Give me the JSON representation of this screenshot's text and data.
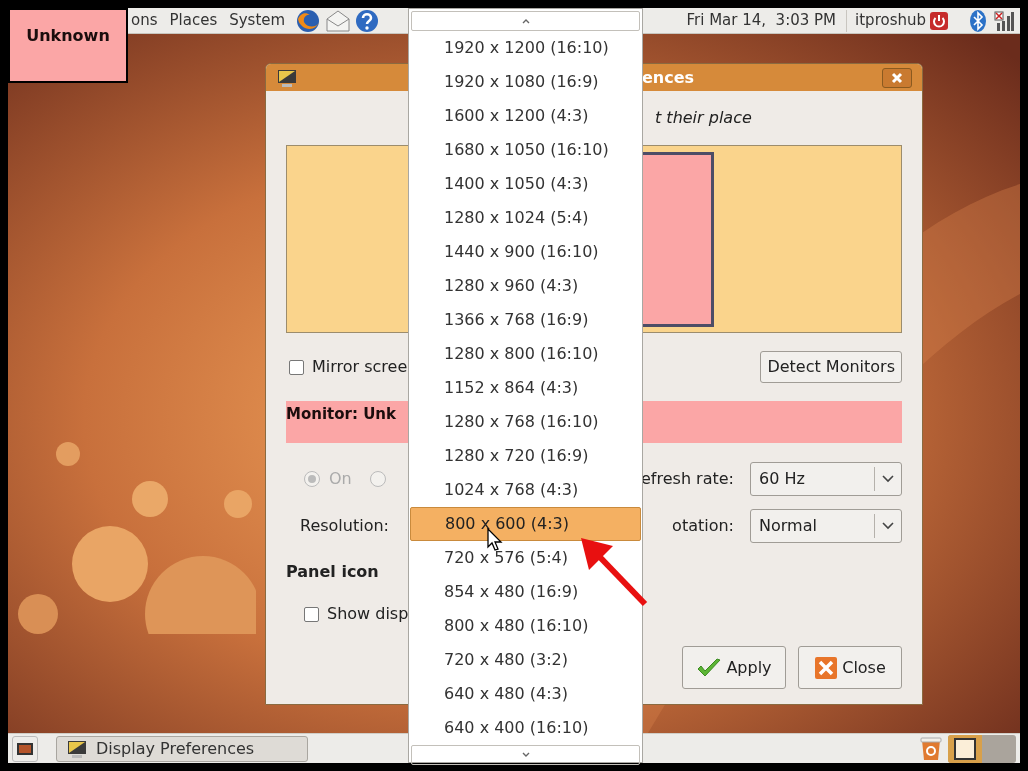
{
  "top_panel": {
    "menus": [
      {
        "label": "ons"
      },
      {
        "label": "Places"
      },
      {
        "label": "System"
      }
    ],
    "clock": "Fri Mar 14,  3:03 PM",
    "user": "itproshub"
  },
  "monitor_label": {
    "text": "Unknown"
  },
  "dialog": {
    "title": "ences",
    "hint": "t their place",
    "mirror_checkbox": {
      "label": "Mirror scree",
      "checked": false
    },
    "detect_button": {
      "label": "Detect Monitors"
    },
    "monitor_heading": "Monitor: Unk",
    "power_radios": [
      {
        "label": "On",
        "selected": true,
        "disabled": true
      },
      {
        "selected": false,
        "disabled": true
      }
    ],
    "resolution_label": "Resolution:",
    "refresh": {
      "label": "efresh rate:",
      "value": "60 Hz"
    },
    "rotation": {
      "label": "otation:",
      "value": "Normal"
    },
    "panel_icon_heading": "Panel icon",
    "show_checkbox": {
      "label": "Show disp",
      "checked": false
    },
    "buttons": [
      {
        "kind": "apply",
        "label": "Apply"
      },
      {
        "kind": "close",
        "label": "Close"
      }
    ]
  },
  "resolution_list": {
    "items": [
      {
        "label": "1920 x 1200 (16:10)",
        "selected": false
      },
      {
        "label": "1920 x 1080 (16:9)",
        "selected": false
      },
      {
        "label": "1600 x 1200 (4:3)",
        "selected": false
      },
      {
        "label": "1680 x 1050 (16:10)",
        "selected": false
      },
      {
        "label": "1400 x 1050 (4:3)",
        "selected": false
      },
      {
        "label": "1280 x 1024 (5:4)",
        "selected": false
      },
      {
        "label": "1440 x 900 (16:10)",
        "selected": false
      },
      {
        "label": "1280 x 960 (4:3)",
        "selected": false
      },
      {
        "label": "1366 x 768 (16:9)",
        "selected": false
      },
      {
        "label": "1280 x 800 (16:10)",
        "selected": false
      },
      {
        "label": "1152 x 864 (4:3)",
        "selected": false
      },
      {
        "label": "1280 x 768 (16:10)",
        "selected": false
      },
      {
        "label": "1280 x 720 (16:9)",
        "selected": false
      },
      {
        "label": "1024 x 768 (4:3)",
        "selected": false
      },
      {
        "label": "800 x 600 (4:3)",
        "selected": true
      },
      {
        "label": "720 x 576 (5:4)",
        "selected": false
      },
      {
        "label": "854 x 480 (16:9)",
        "selected": false
      },
      {
        "label": "800 x 480 (16:10)",
        "selected": false
      },
      {
        "label": "720 x 480 (3:2)",
        "selected": false
      },
      {
        "label": "640 x 480 (4:3)",
        "selected": false
      },
      {
        "label": "640 x 400 (16:10)",
        "selected": false
      }
    ]
  },
  "bottom_panel": {
    "tasks": [
      {
        "label": "Display Preferences"
      }
    ]
  }
}
